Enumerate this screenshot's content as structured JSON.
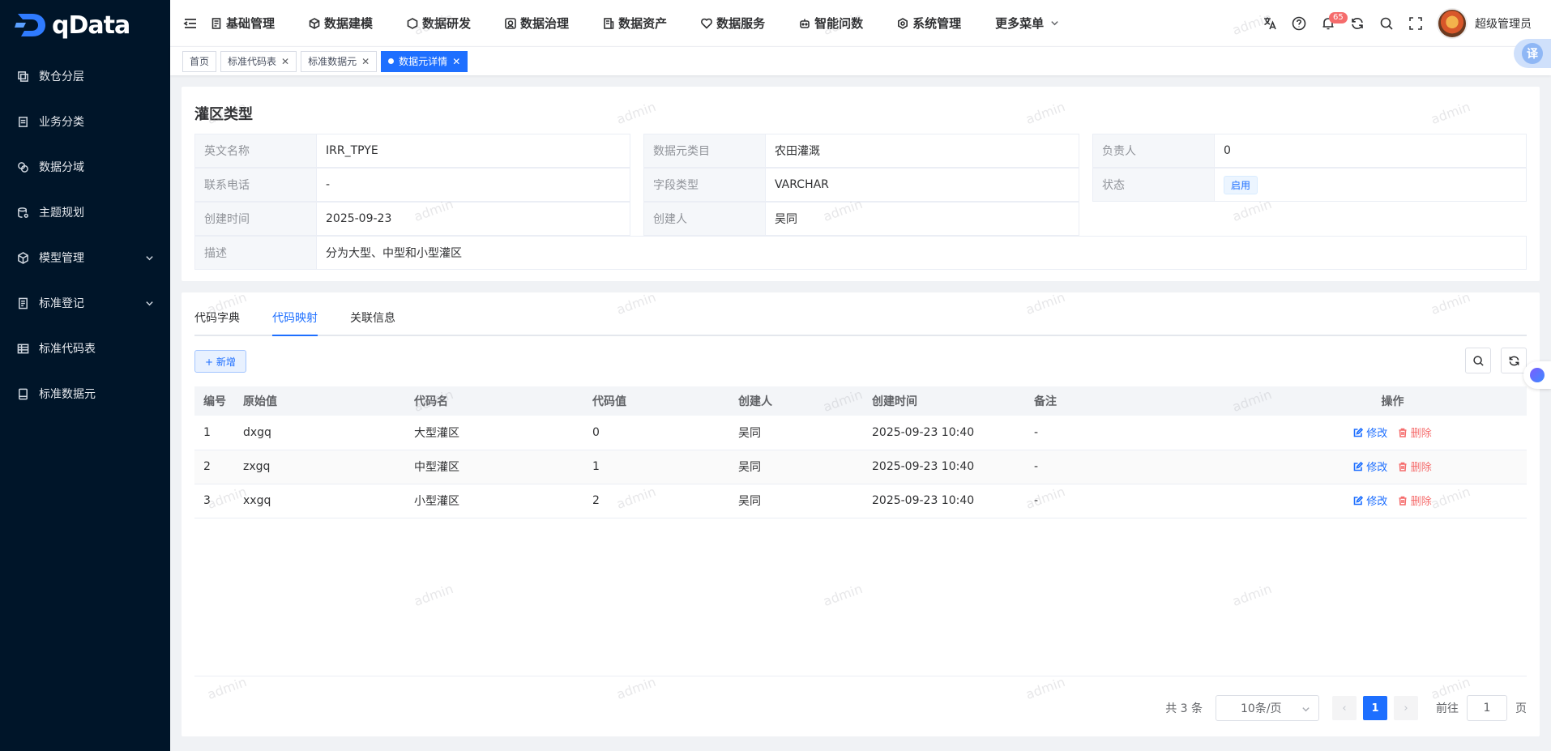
{
  "app": {
    "logo_text": "qData"
  },
  "sidebar": {
    "items": [
      {
        "label": "数仓分层",
        "icon": "layers-icon",
        "expandable": false
      },
      {
        "label": "业务分类",
        "icon": "classify-icon",
        "expandable": false
      },
      {
        "label": "数据分域",
        "icon": "domain-icon",
        "expandable": false
      },
      {
        "label": "主题规划",
        "icon": "topic-icon",
        "expandable": false
      },
      {
        "label": "模型管理",
        "icon": "cube-icon",
        "expandable": true
      },
      {
        "label": "标准登记",
        "icon": "register-icon",
        "expandable": true
      },
      {
        "label": "标准代码表",
        "icon": "table-icon",
        "expandable": false
      },
      {
        "label": "标准数据元",
        "icon": "element-icon",
        "expandable": false
      }
    ]
  },
  "topnav": {
    "items": [
      {
        "label": "基础管理",
        "icon": "doc-icon"
      },
      {
        "label": "数据建模",
        "icon": "cube-icon"
      },
      {
        "label": "数据研发",
        "icon": "cube-icon"
      },
      {
        "label": "数据治理",
        "icon": "govern-icon"
      },
      {
        "label": "数据资产",
        "icon": "asset-icon"
      },
      {
        "label": "数据服务",
        "icon": "service-icon"
      },
      {
        "label": "智能问数",
        "icon": "robot-icon"
      },
      {
        "label": "系统管理",
        "icon": "settings-icon"
      }
    ],
    "more_label": "更多菜单",
    "notification_count": "65",
    "username": "超级管理员"
  },
  "tags": [
    {
      "label": "首页",
      "closable": false,
      "active": false
    },
    {
      "label": "标准代码表",
      "closable": true,
      "active": false
    },
    {
      "label": "标准数据元",
      "closable": true,
      "active": false
    },
    {
      "label": "数据元详情",
      "closable": true,
      "active": true
    }
  ],
  "translate_label": "译",
  "detail": {
    "title": "灌区类型",
    "fields": {
      "en_name_label": "英文名称",
      "en_name": "IRR_TPYE",
      "category_label": "数据元类目",
      "category": "农田灌溉",
      "owner_label": "负责人",
      "owner": "0",
      "phone_label": "联系电话",
      "phone": "-",
      "field_type_label": "字段类型",
      "field_type": "VARCHAR",
      "status_label": "状态",
      "status": "启用",
      "created_label": "创建时间",
      "created": "2025-09-23",
      "creator_label": "创建人",
      "creator": "吴同",
      "desc_label": "描述",
      "desc": "分为大型、中型和小型灌区"
    }
  },
  "tabs": [
    "代码字典",
    "代码映射",
    "关联信息"
  ],
  "active_tab": 1,
  "toolbar": {
    "add_label": "+ 新增"
  },
  "table": {
    "headers": [
      "编号",
      "原始值",
      "代码名",
      "代码值",
      "创建人",
      "创建时间",
      "备注",
      "操作"
    ],
    "rows": [
      {
        "id": "1",
        "raw": "dxgq",
        "name": "大型灌区",
        "code": "0",
        "creator": "吴同",
        "created": "2025-09-23 10:40",
        "remark": "-"
      },
      {
        "id": "2",
        "raw": "zxgq",
        "name": "中型灌区",
        "code": "1",
        "creator": "吴同",
        "created": "2025-09-23 10:40",
        "remark": "-"
      },
      {
        "id": "3",
        "raw": "xxgq",
        "name": "小型灌区",
        "code": "2",
        "creator": "吴同",
        "created": "2025-09-23 10:40",
        "remark": "-"
      }
    ],
    "edit_label": "修改",
    "delete_label": "删除"
  },
  "pagination": {
    "total_text": "共 3 条",
    "page_size": "10条/页",
    "current_page": "1",
    "goto_prefix": "前往",
    "goto_value": "1",
    "goto_suffix": "页"
  },
  "watermark": "admin"
}
